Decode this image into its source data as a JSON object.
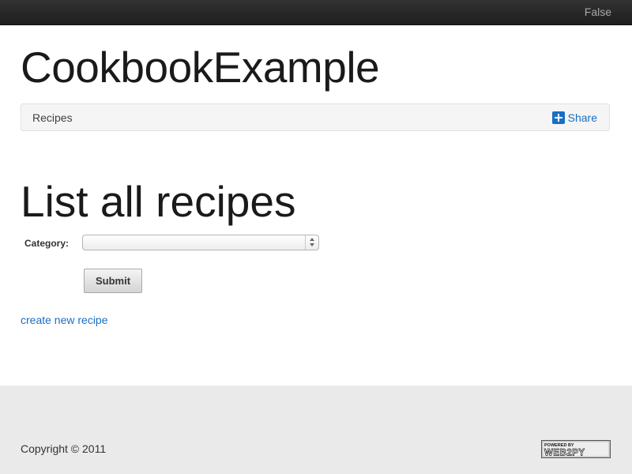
{
  "topbar": {
    "link_label": "False"
  },
  "app": {
    "title": "CookbookExample"
  },
  "breadcrumb": {
    "items": [
      "Recipes"
    ],
    "share_label": "Share",
    "share_icon": "plus-square-icon"
  },
  "main": {
    "title": "List all recipes",
    "form": {
      "category_label": "Category:",
      "category_value": "",
      "submit_label": "Submit"
    },
    "create_link": "create new recipe"
  },
  "footer": {
    "copyright": "Copyright © 2011",
    "badge_top": "POWERED BY",
    "badge_main": "WEB2PY"
  },
  "colors": {
    "link": "#1a6ec4",
    "topbar": "#222222",
    "footer_bg": "#eaeaea"
  }
}
